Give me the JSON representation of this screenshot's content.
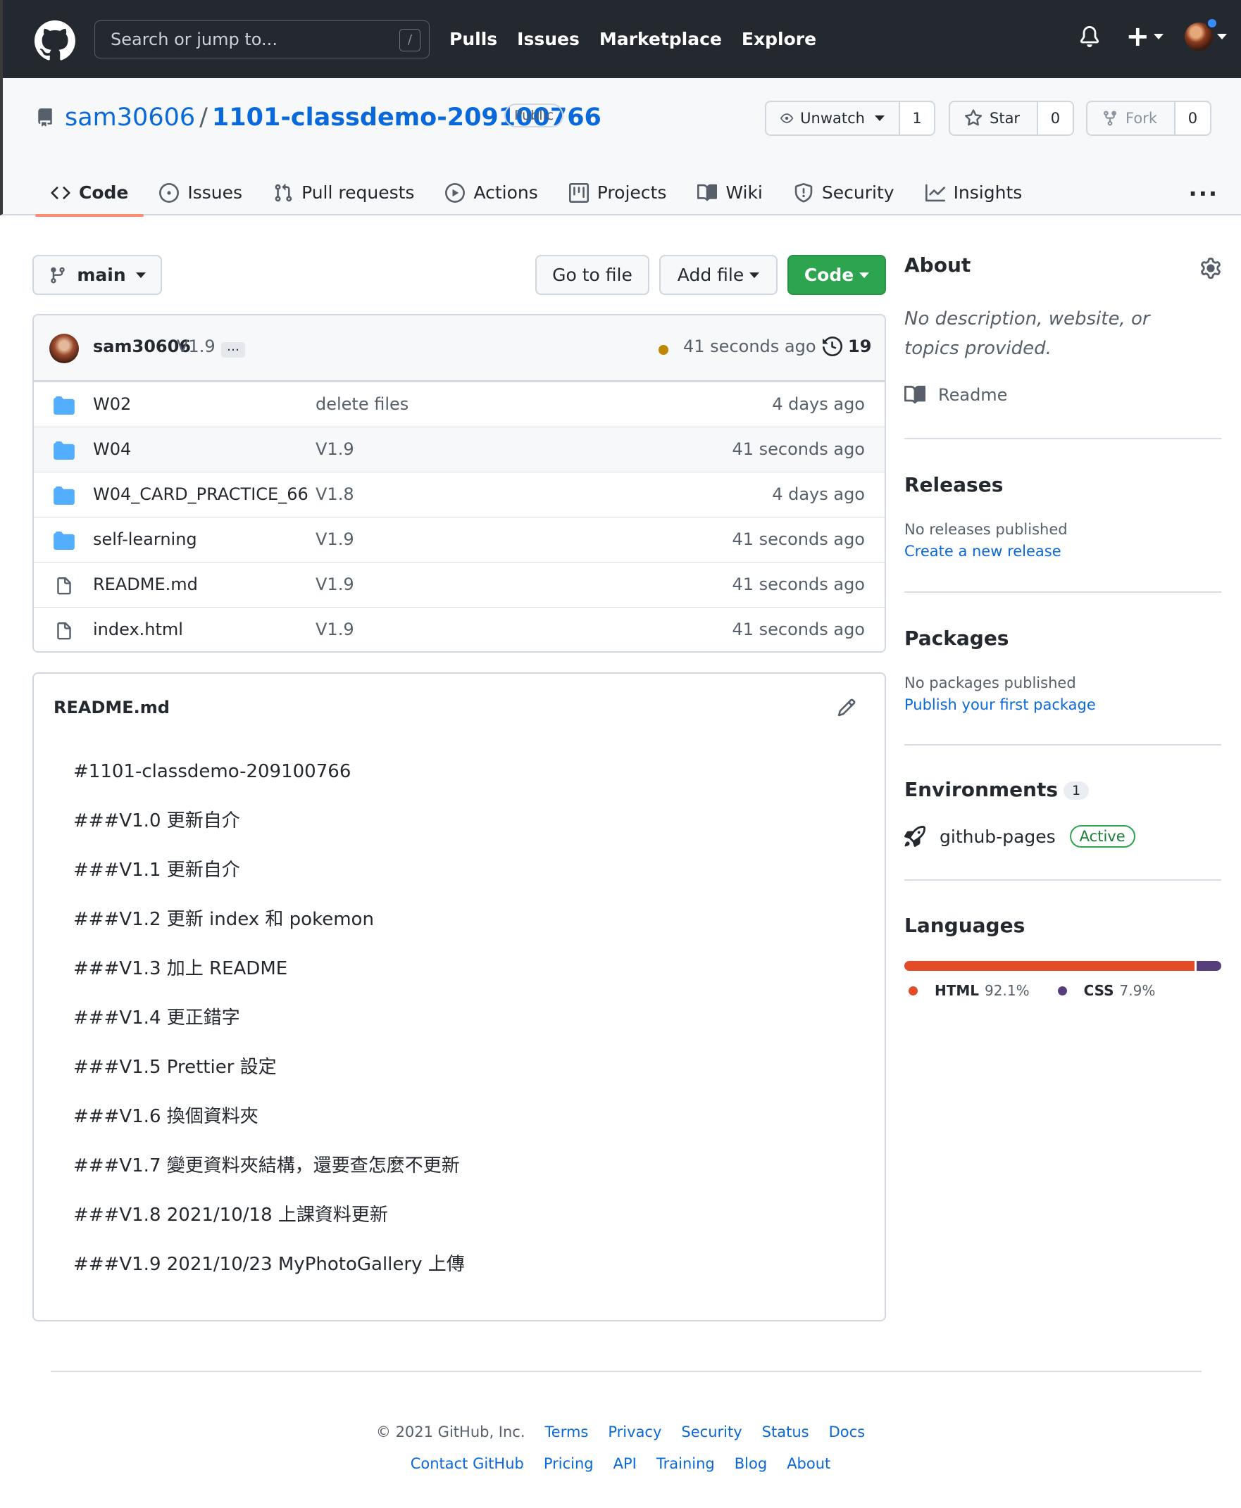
{
  "header": {
    "search_placeholder": "Search or jump to...",
    "search_shortcut": "/",
    "nav": [
      "Pulls",
      "Issues",
      "Marketplace",
      "Explore"
    ]
  },
  "repo": {
    "owner": "sam30606",
    "separator": "/",
    "name": "1101-classdemo-209100766",
    "visibility": "Public",
    "unwatch_label": "Unwatch",
    "watch_count": "1",
    "star_label": "Star",
    "star_count": "0",
    "fork_label": "Fork",
    "fork_count": "0"
  },
  "tabs": [
    {
      "label": "Code",
      "icon": "code-icon"
    },
    {
      "label": "Issues",
      "icon": "issue-icon"
    },
    {
      "label": "Pull requests",
      "icon": "pull-request-icon"
    },
    {
      "label": "Actions",
      "icon": "play-icon"
    },
    {
      "label": "Projects",
      "icon": "project-icon"
    },
    {
      "label": "Wiki",
      "icon": "book-icon"
    },
    {
      "label": "Security",
      "icon": "shield-icon"
    },
    {
      "label": "Insights",
      "icon": "graph-icon"
    }
  ],
  "toolbar": {
    "branch": "main",
    "go_to_file": "Go to file",
    "add_file": "Add file",
    "code": "Code"
  },
  "commit": {
    "author": "sam30606",
    "message": "V1.9",
    "ellipsis": "…",
    "time": "41 seconds ago",
    "history_count": "19"
  },
  "files": [
    {
      "type": "dir",
      "name": "W02",
      "message": "delete files",
      "age": "4 days ago"
    },
    {
      "type": "dir",
      "name": "W04",
      "message": "V1.9",
      "age": "41 seconds ago"
    },
    {
      "type": "dir",
      "name": "W04_CARD_PRACTICE_66",
      "message": "V1.8",
      "age": "4 days ago"
    },
    {
      "type": "dir",
      "name": "self-learning",
      "message": "V1.9",
      "age": "41 seconds ago"
    },
    {
      "type": "file",
      "name": "README.md",
      "message": "V1.9",
      "age": "41 seconds ago"
    },
    {
      "type": "file",
      "name": "index.html",
      "message": "V1.9",
      "age": "41 seconds ago"
    }
  ],
  "readme": {
    "title": "README.md",
    "lines": [
      "#1101-classdemo-209100766",
      "###V1.0 更新自介",
      "###V1.1 更新自介",
      "###V1.2 更新 index 和 pokemon",
      "###V1.3 加上 README",
      "###V1.4 更正錯字",
      "###V1.5 Prettier 設定",
      "###V1.6 換個資料夾",
      "###V1.7 變更資料夾結構，還要查怎麼不更新",
      "###V1.8 2021/10/18 上課資料更新",
      "###V1.9 2021/10/23 MyPhotoGallery 上傳"
    ]
  },
  "sidebar": {
    "about_title": "About",
    "about_desc": "No description, website, or topics provided.",
    "readme_label": "Readme",
    "releases_title": "Releases",
    "releases_sub": "No releases published",
    "releases_link": "Create a new release",
    "packages_title": "Packages",
    "packages_sub": "No packages published",
    "packages_link": "Publish your first package",
    "environments_title": "Environments",
    "environments_count": "1",
    "env_name": "github-pages",
    "env_status": "Active",
    "languages_title": "Languages",
    "languages": [
      {
        "name": "HTML",
        "percent": "92.1%",
        "value": 92.1,
        "color": "#e34c26"
      },
      {
        "name": "CSS",
        "percent": "7.9%",
        "value": 7.9,
        "color": "#563d7c"
      }
    ]
  },
  "footer": {
    "copyright": "© 2021 GitHub, Inc.",
    "row1": [
      "Terms",
      "Privacy",
      "Security",
      "Status",
      "Docs"
    ],
    "row2": [
      "Contact GitHub",
      "Pricing",
      "API",
      "Training",
      "Blog",
      "About"
    ]
  },
  "colors": {
    "header_bg": "#24292f",
    "link": "#0969da",
    "primary_button": "#2da44e",
    "tab_underline": "#fd8c73",
    "folder": "#54aeff"
  }
}
